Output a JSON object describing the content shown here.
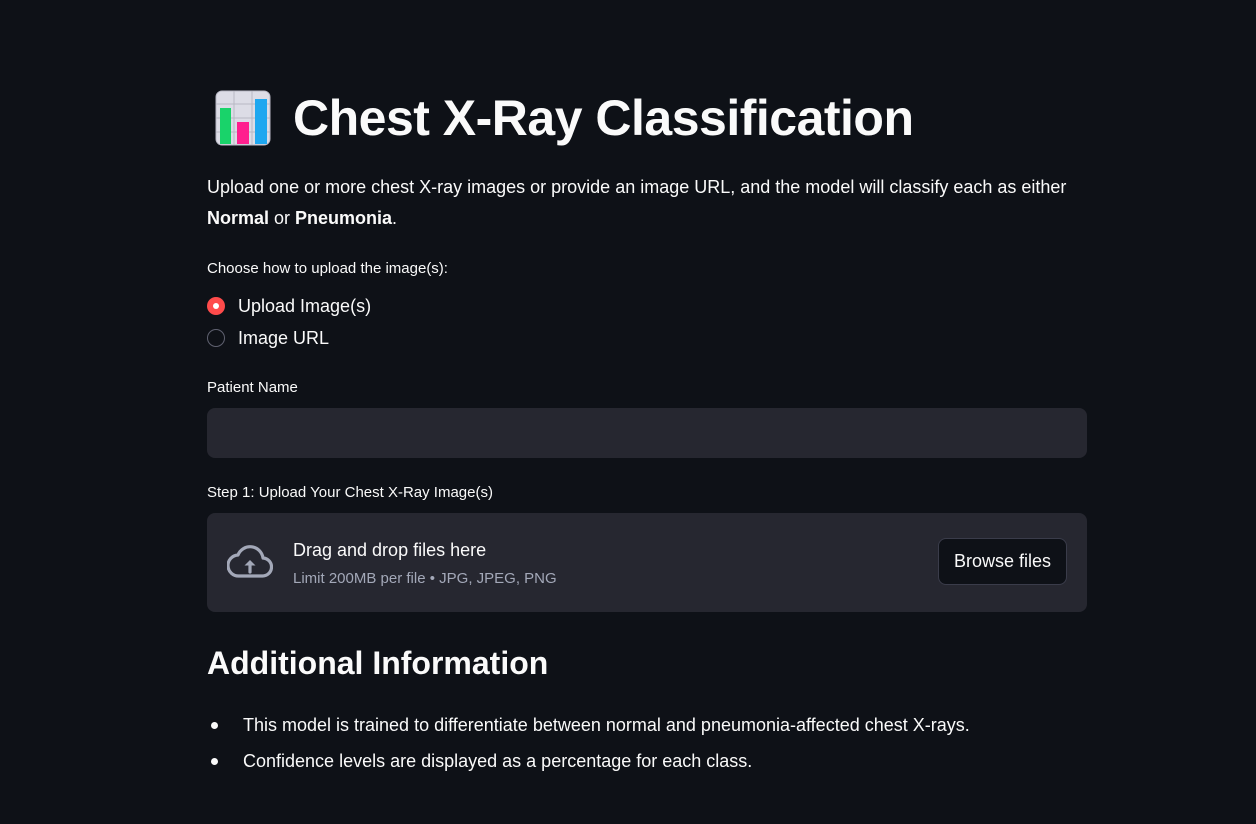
{
  "header": {
    "icon": "bar-chart-icon",
    "title": "Chest X-Ray Classification"
  },
  "intro": {
    "text_before": "Upload one or more chest X-ray images or provide an image URL, and the model will classify each as either ",
    "class_normal": "Normal",
    "text_or": " or ",
    "class_pneumonia": "Pneumonia",
    "text_end": "."
  },
  "upload_method": {
    "label": "Choose how to upload the image(s):",
    "options": [
      {
        "label": "Upload Image(s)",
        "selected": true
      },
      {
        "label": "Image URL",
        "selected": false
      }
    ]
  },
  "patient_name": {
    "label": "Patient Name",
    "value": ""
  },
  "uploader": {
    "label": "Step 1: Upload Your Chest X-Ray Image(s)",
    "drop_text": "Drag and drop files here",
    "limit_text": "Limit 200MB per file • JPG, JPEG, PNG",
    "browse_label": "Browse files",
    "icon": "cloud-upload-icon"
  },
  "additional_info": {
    "heading": "Additional Information",
    "bullets": [
      "This model is trained to differentiate between normal and pneumonia-affected chest X-rays.",
      "Confidence levels are displayed as a percentage for each class."
    ]
  },
  "colors": {
    "background": "#0e1117",
    "widget_bg": "#262730",
    "accent": "#ff4b4b",
    "text": "#fafafa",
    "muted_text": "#a3a8b8"
  }
}
